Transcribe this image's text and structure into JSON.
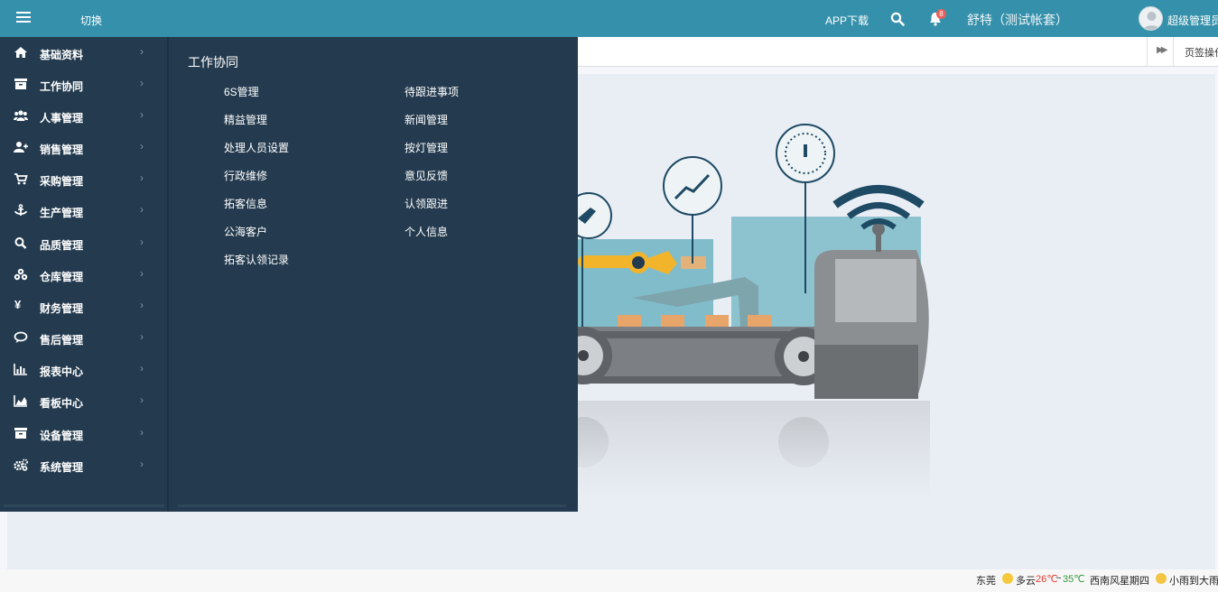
{
  "header": {
    "switch_label": "切换",
    "app_download": "APP下载",
    "notification_count": "8",
    "company": "舒特（测试帐套）",
    "user": "超级管理员",
    "accent_color": "#3591ab"
  },
  "tabs": {
    "page_ops": "页签操作"
  },
  "sidebar": {
    "items": [
      {
        "label": "基础资料",
        "icon": "home-icon"
      },
      {
        "label": "工作协同",
        "icon": "archive-icon"
      },
      {
        "label": "人事管理",
        "icon": "users-icon"
      },
      {
        "label": "销售管理",
        "icon": "user-plus-icon"
      },
      {
        "label": "采购管理",
        "icon": "cart-icon"
      },
      {
        "label": "生产管理",
        "icon": "anchor-icon"
      },
      {
        "label": "品质管理",
        "icon": "search-icon"
      },
      {
        "label": "仓库管理",
        "icon": "cubes-icon"
      },
      {
        "label": "财务管理",
        "icon": "yen-icon"
      },
      {
        "label": "售后管理",
        "icon": "chat-icon"
      },
      {
        "label": "报表中心",
        "icon": "bar-chart-icon"
      },
      {
        "label": "看板中心",
        "icon": "area-chart-icon"
      },
      {
        "label": "设备管理",
        "icon": "archive-icon"
      },
      {
        "label": "系统管理",
        "icon": "gears-icon"
      }
    ]
  },
  "flyout": {
    "title": "工作协同",
    "left": [
      "6S管理",
      "精益管理",
      "处理人员设置",
      "行政维修",
      "拓客信息",
      "公海客户",
      "拓客认领记录"
    ],
    "right": [
      "待跟进事项",
      "新闻管理",
      "按灯管理",
      "意见反馈",
      "认领跟进",
      "个人信息"
    ]
  },
  "status": {
    "city": "东莞",
    "weather": "多云",
    "temp_low": "26℃",
    "temp_sep": "~",
    "temp_high": "35℃",
    "wind": "西南风",
    "weekday": "星期四",
    "forecast": "小雨到大雨"
  }
}
